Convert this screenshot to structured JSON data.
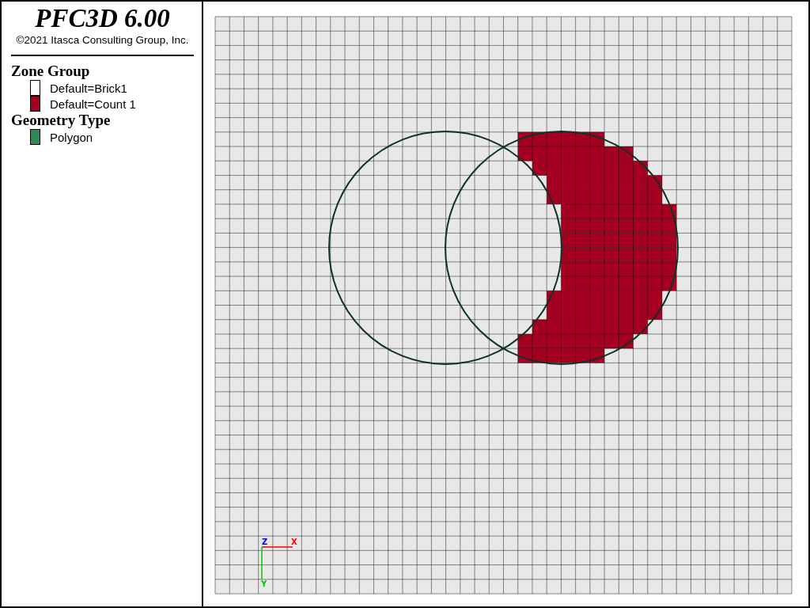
{
  "title": "PFC3D 6.00",
  "copyright": "©2021 Itasca Consulting Group, Inc.",
  "legend": [
    {
      "heading": "Zone Group",
      "items": [
        {
          "label": "Default=Brick1",
          "color": "#ffffff"
        },
        {
          "label": "Default=Count 1",
          "color": "#a50021"
        }
      ]
    },
    {
      "heading": "Geometry Type",
      "items": [
        {
          "label": "Polygon",
          "color": "#2e8b57"
        }
      ]
    }
  ],
  "axes": [
    {
      "label": "Z",
      "color": "#0000ff"
    },
    {
      "label": "X",
      "color": "#ff0000"
    },
    {
      "label": "Y",
      "color": "#00cc00"
    }
  ]
}
